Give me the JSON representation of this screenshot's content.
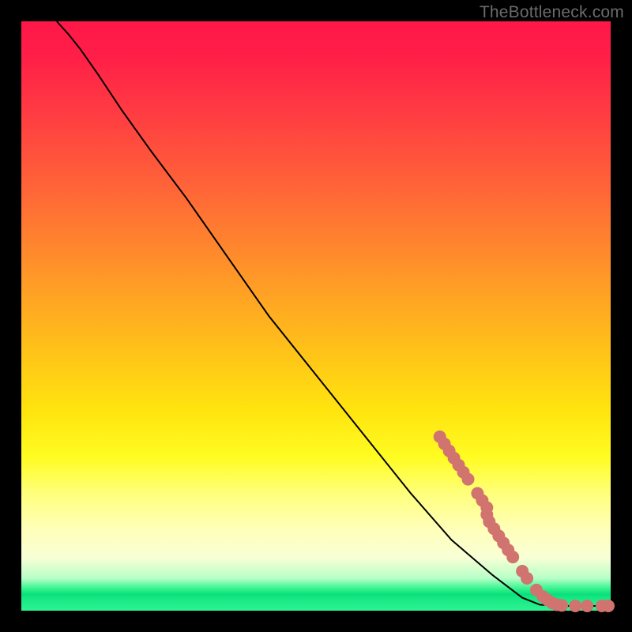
{
  "watermark": "TheBottleneck.com",
  "colors": {
    "point_fill": "#d1736e",
    "curve_stroke": "#000000"
  },
  "chart_data": {
    "type": "line",
    "title": "",
    "xlabel": "",
    "ylabel": "",
    "xlim": [
      0,
      100
    ],
    "ylim": [
      0,
      100
    ],
    "curve_note": "Monotonically decreasing curve from top-left toward bottom-right, flattening to ~0 near x≈88 then horizontal to 100. Values estimated from pixel positions.",
    "curve": [
      {
        "x": 6.0,
        "y": 100.0
      },
      {
        "x": 8.0,
        "y": 97.8
      },
      {
        "x": 10.0,
        "y": 95.3
      },
      {
        "x": 13.0,
        "y": 91.0
      },
      {
        "x": 17.0,
        "y": 85.0
      },
      {
        "x": 22.0,
        "y": 78.0
      },
      {
        "x": 28.0,
        "y": 70.0
      },
      {
        "x": 35.0,
        "y": 60.0
      },
      {
        "x": 42.0,
        "y": 50.0
      },
      {
        "x": 50.0,
        "y": 40.0
      },
      {
        "x": 58.0,
        "y": 30.0
      },
      {
        "x": 66.0,
        "y": 20.0
      },
      {
        "x": 73.0,
        "y": 12.0
      },
      {
        "x": 80.0,
        "y": 6.0
      },
      {
        "x": 85.0,
        "y": 2.2
      },
      {
        "x": 88.0,
        "y": 1.0
      },
      {
        "x": 92.0,
        "y": 0.8
      },
      {
        "x": 100.0,
        "y": 0.8
      }
    ],
    "points_note": "Salmon scatter points along the lower-right portion of the curve and its flat tail. r≈8px visual.",
    "points": [
      {
        "x": 71.0,
        "y": 29.5
      },
      {
        "x": 71.8,
        "y": 28.3
      },
      {
        "x": 72.6,
        "y": 27.1
      },
      {
        "x": 73.4,
        "y": 25.9
      },
      {
        "x": 74.2,
        "y": 24.7
      },
      {
        "x": 75.0,
        "y": 23.5
      },
      {
        "x": 75.8,
        "y": 22.3
      },
      {
        "x": 77.4,
        "y": 19.9
      },
      {
        "x": 78.2,
        "y": 18.7
      },
      {
        "x": 79.0,
        "y": 17.5
      },
      {
        "x": 79.0,
        "y": 16.3
      },
      {
        "x": 79.4,
        "y": 15.1
      },
      {
        "x": 80.2,
        "y": 13.9
      },
      {
        "x": 81.0,
        "y": 12.7
      },
      {
        "x": 81.8,
        "y": 11.5
      },
      {
        "x": 82.6,
        "y": 10.3
      },
      {
        "x": 83.4,
        "y": 9.1
      },
      {
        "x": 85.0,
        "y": 6.7
      },
      {
        "x": 85.8,
        "y": 5.5
      },
      {
        "x": 87.4,
        "y": 3.5
      },
      {
        "x": 88.5,
        "y": 2.4
      },
      {
        "x": 89.3,
        "y": 1.8
      },
      {
        "x": 90.1,
        "y": 1.3
      },
      {
        "x": 90.9,
        "y": 1.0
      },
      {
        "x": 91.7,
        "y": 0.9
      },
      {
        "x": 94.0,
        "y": 0.8
      },
      {
        "x": 96.0,
        "y": 0.8
      },
      {
        "x": 98.5,
        "y": 0.8
      },
      {
        "x": 99.6,
        "y": 0.8
      }
    ],
    "point_radius_px": 8
  }
}
